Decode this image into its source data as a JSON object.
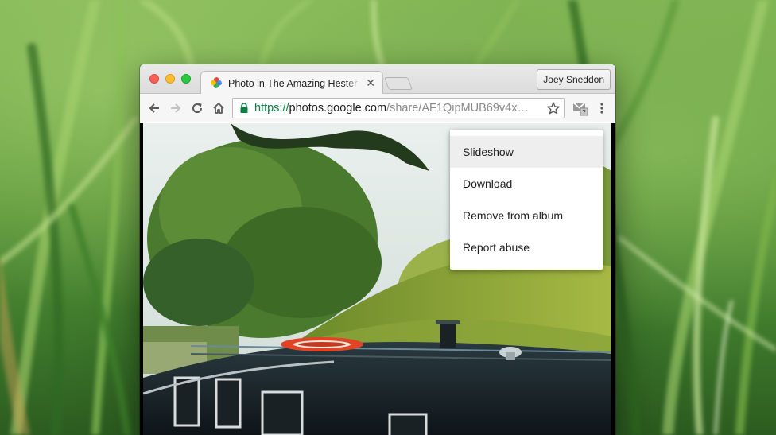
{
  "browser": {
    "tab": {
      "title": "Photo in The Amazing Hester",
      "favicon": "google-photos-pinwheel-icon",
      "close_glyph": "✕"
    },
    "profile_name": "Joey Sneddon",
    "url": {
      "scheme": "https://",
      "host": "photos.google.com",
      "path": "/share/AF1QipMUB69v4x…"
    },
    "icons": [
      "back-arrow-icon",
      "forward-arrow-icon",
      "reload-icon",
      "home-icon",
      "lock-icon",
      "star-icon",
      "gmail-checker-extension-icon",
      "more-vert-icon"
    ]
  },
  "context_menu": {
    "items": [
      {
        "label": "Slideshow",
        "highlighted": true
      },
      {
        "label": "Download",
        "highlighted": false
      },
      {
        "label": "Remove from album",
        "highlighted": false
      },
      {
        "label": "Report abuse",
        "highlighted": false
      }
    ]
  },
  "colors": {
    "secure_green": "#0b8043",
    "menu_highlight": "#eeeeee",
    "close_red": "#fc5f57",
    "minimize_yellow": "#fdbc2e",
    "maximize_green": "#29c940"
  }
}
